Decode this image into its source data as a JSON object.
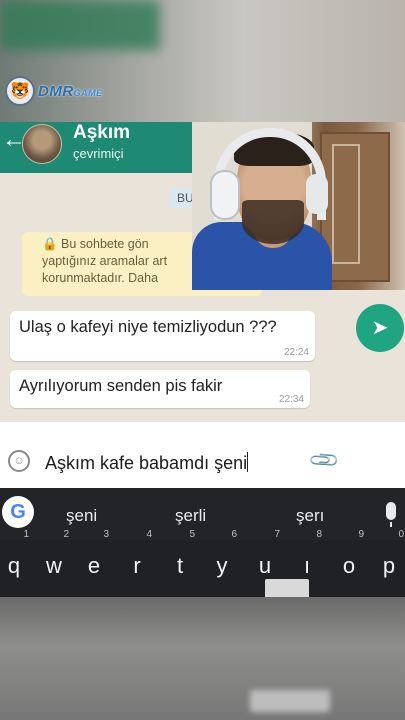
{
  "watermark": {
    "brand": "DMR",
    "brand_suffix": "GAME"
  },
  "chat": {
    "contact_name": "Aşkım",
    "contact_status": "çevrimiçi",
    "date_chip": "BU",
    "encryption_notice": [
      "🔒 Bu sohbete gön",
      "yaptığınız aramalar art",
      "korunmaktadır. Daha"
    ],
    "messages": [
      {
        "text": "Ulaş o kafeyi niye temizliyodun ???",
        "time": "22:24"
      },
      {
        "text": "Ayrılıyorum senden pis fakir",
        "time": "22:34"
      }
    ],
    "input_value": "Aşkım kafe babamdı şeni"
  },
  "keyboard": {
    "suggestions": [
      "şeni",
      "şerli",
      "şerı"
    ],
    "keys": [
      {
        "label": "q",
        "hint": "1"
      },
      {
        "label": "w",
        "hint": "2"
      },
      {
        "label": "e",
        "hint": "3"
      },
      {
        "label": "r",
        "hint": "4"
      },
      {
        "label": "t",
        "hint": "5"
      },
      {
        "label": "y",
        "hint": "6"
      },
      {
        "label": "u",
        "hint": "7"
      },
      {
        "label": "ı",
        "hint": "8"
      },
      {
        "label": "o",
        "hint": "9"
      },
      {
        "label": "p",
        "hint": "0"
      }
    ]
  },
  "colors": {
    "header": "#1f8a74",
    "send": "#1fa582",
    "notice": "#fbf0c4",
    "keyboard": "#202124"
  },
  "icons": [
    "back-arrow-icon",
    "emoji-icon",
    "attach-icon",
    "send-icon",
    "google-icon",
    "mic-icon"
  ]
}
